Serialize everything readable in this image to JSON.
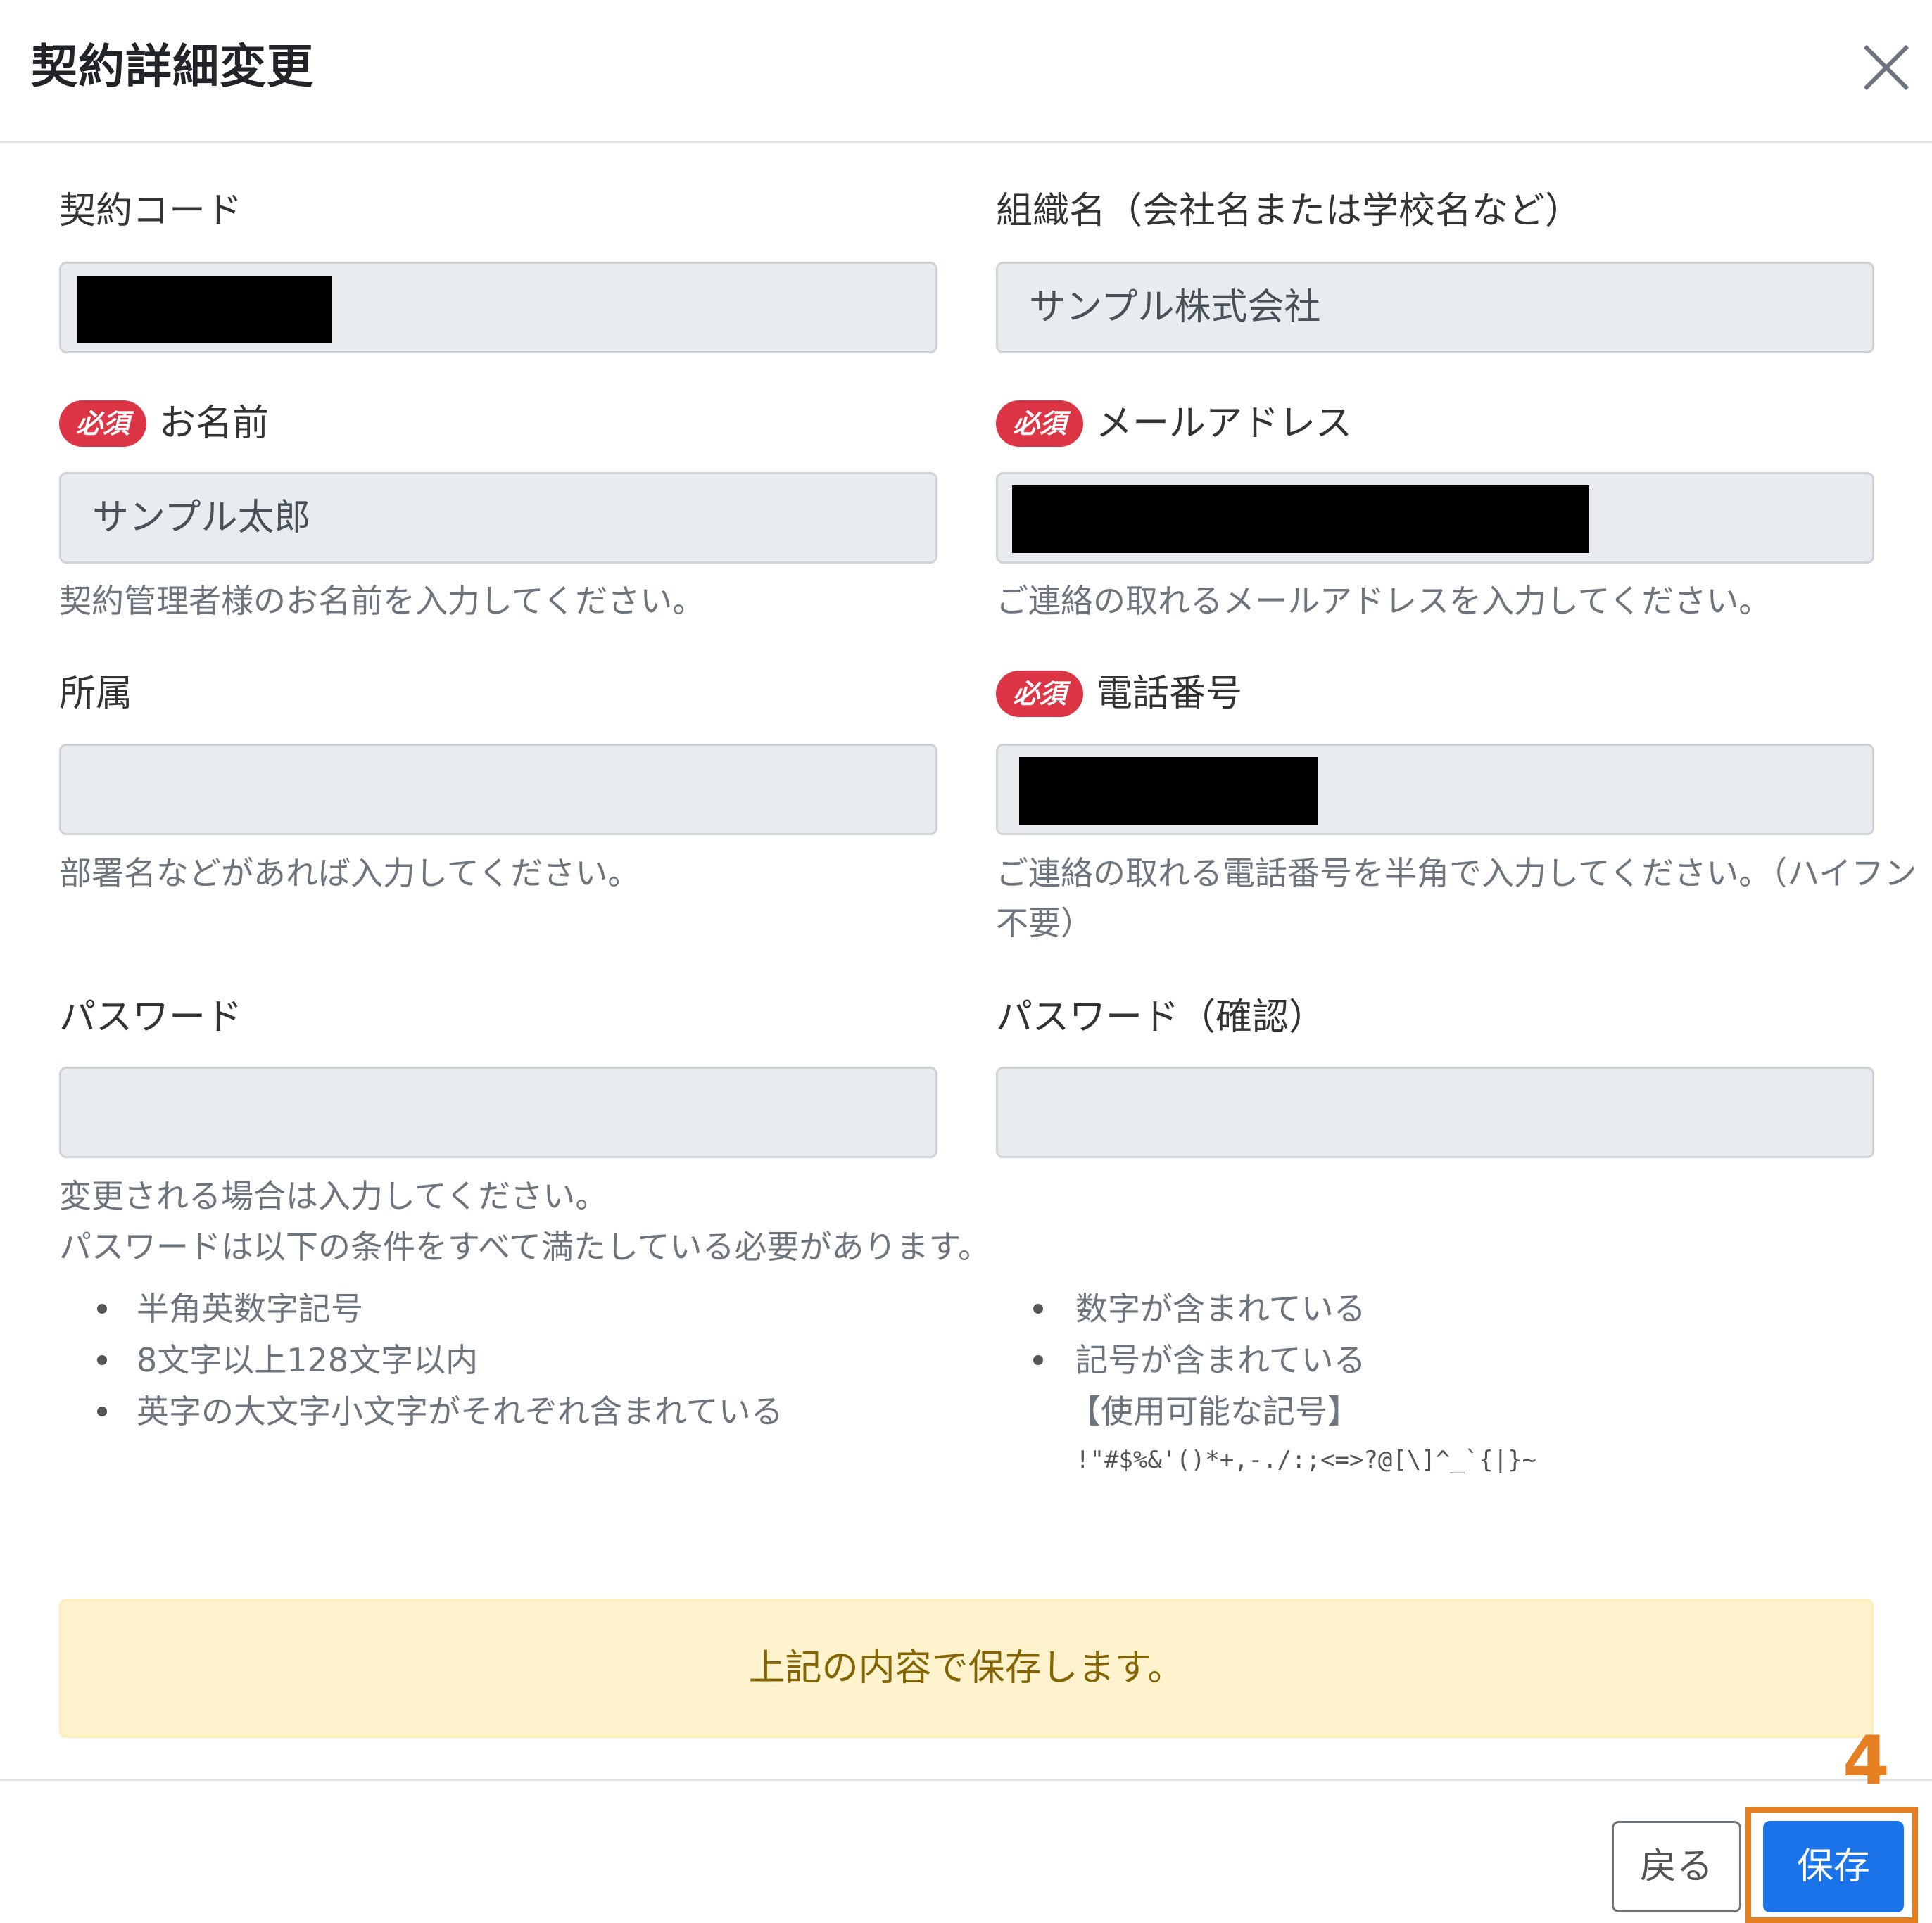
{
  "modal": {
    "title": "契約詳細変更"
  },
  "required_badge": "必須",
  "fields": {
    "contract_code": {
      "label": "契約コード"
    },
    "organization": {
      "label": "組織名（会社名または学校名など）",
      "value": "サンプル株式会社"
    },
    "name": {
      "label": "お名前",
      "value": "サンプル太郎",
      "help": "契約管理者様のお名前を入力してください。"
    },
    "email": {
      "label": "メールアドレス",
      "help": "ご連絡の取れるメールアドレスを入力してください。"
    },
    "department": {
      "label": "所属",
      "value": "",
      "help": "部署名などがあれば入力してください。"
    },
    "phone": {
      "label": "電話番号",
      "help_line1": "ご連絡の取れる電話番号を半角で入力してください。（ハイフン",
      "help_line2": "不要）"
    },
    "password": {
      "label": "パスワード",
      "value": "",
      "help_line1": "変更される場合は入力してください。",
      "help_line2": "パスワードは以下の条件をすべて満たしている必要があります。"
    },
    "password_confirm": {
      "label": "パスワード（確認）",
      "value": ""
    }
  },
  "password_rules_left": [
    "半角英数字記号",
    "8文字以上128文字以内",
    "英字の大文字小文字がそれぞれ含まれている"
  ],
  "password_rules_right": [
    "数字が含まれている",
    "記号が含まれている"
  ],
  "symbols_note": "【使用可能な記号】",
  "symbols": "!\"#$%&'()*+,-./:;<=>?@[\\]^_`{|}~",
  "alert": "上記の内容で保存します。",
  "buttons": {
    "back": "戻る",
    "save": "保存"
  },
  "annotation": {
    "step": "4"
  },
  "colors": {
    "primary": "#1a73e8",
    "danger": "#dc3545",
    "alert_bg": "#fff3cd",
    "highlight": "#e67e22"
  },
  "icons": {
    "close": "close-icon"
  }
}
